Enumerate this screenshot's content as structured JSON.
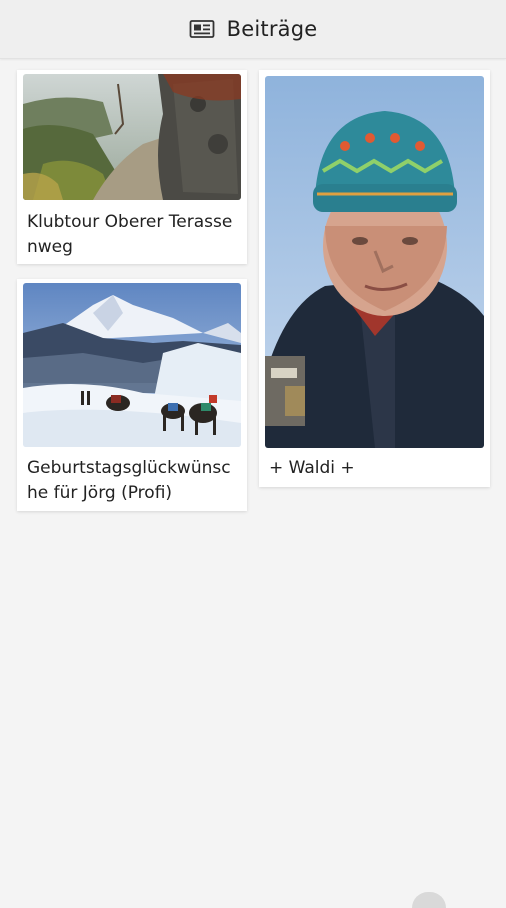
{
  "appbar": {
    "icon": "newspaper-icon",
    "title": "Beiträge"
  },
  "posts": [
    {
      "title": "Klubtour Oberer Terassenweg",
      "image": "mountain-trail-photo"
    },
    {
      "title": "Geburtstagsglückwünsche für Jörg (Profi)",
      "image": "himalaya-trek-painting"
    },
    {
      "title": "+ Waldi +",
      "image": "portrait-man-knit-hat-photo"
    }
  ]
}
